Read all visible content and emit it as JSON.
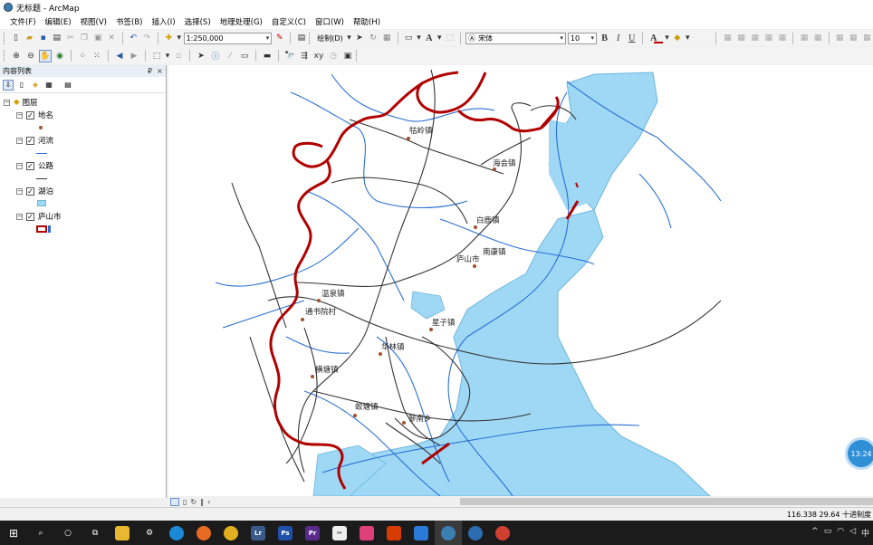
{
  "window": {
    "title": "无标题 - ArcMap"
  },
  "menu": [
    "文件(F)",
    "编辑(E)",
    "视图(V)",
    "书签(B)",
    "插入(I)",
    "选择(S)",
    "地理处理(G)",
    "自定义(C)",
    "窗口(W)",
    "帮助(H)"
  ],
  "toolbar": {
    "scale_value": "1:250,000",
    "draw_label": "绘制(D)",
    "font_name": "宋体",
    "font_size": "10",
    "bold": "B",
    "italic": "I",
    "underline": "U",
    "text_tool": "A",
    "font_color_letter": "A",
    "font_color": "#c00000",
    "fill_color": "#ffd000"
  },
  "toc": {
    "title": "内容列表",
    "pin": "₽",
    "close": "×",
    "group": "图层",
    "layers": [
      {
        "name": "地名",
        "checked": "✓",
        "symbol": "point",
        "color": "#a0522d"
      },
      {
        "name": "河流",
        "checked": "✓",
        "symbol": "line",
        "color": "#2a6fd4"
      },
      {
        "name": "公路",
        "checked": "✓",
        "symbol": "line",
        "color": "#333333"
      },
      {
        "name": "湖泊",
        "checked": "✓",
        "symbol": "fill",
        "color": "#9ed8f5"
      },
      {
        "name": "庐山市",
        "checked": "✓",
        "symbol": "polygon-outline",
        "color": "#b00000"
      }
    ]
  },
  "map": {
    "towns": [
      "牯岭镇",
      "海会镇",
      "白鹿镇",
      "南康镇",
      "庐山市",
      "温泉镇",
      "通书院村",
      "星子镇",
      "华林镇",
      "横塘镇",
      "蛟塘镇",
      "蓼南乡"
    ],
    "colors": {
      "lake": "#9ed8f5",
      "river": "#2a6fd4",
      "road": "#333333",
      "boundary": "#b00000",
      "place": "#a0522d"
    }
  },
  "status": {
    "coords": "116.338  29.64 十进制度"
  },
  "clock_badge": "13:24",
  "taskbar": {
    "apps": [
      {
        "name": "Lr",
        "color": "#3a5a8a"
      },
      {
        "name": "Ps",
        "color": "#1f4fa8"
      },
      {
        "name": "Pr",
        "color": "#5a2a8a"
      }
    ],
    "tray_time": "中"
  }
}
